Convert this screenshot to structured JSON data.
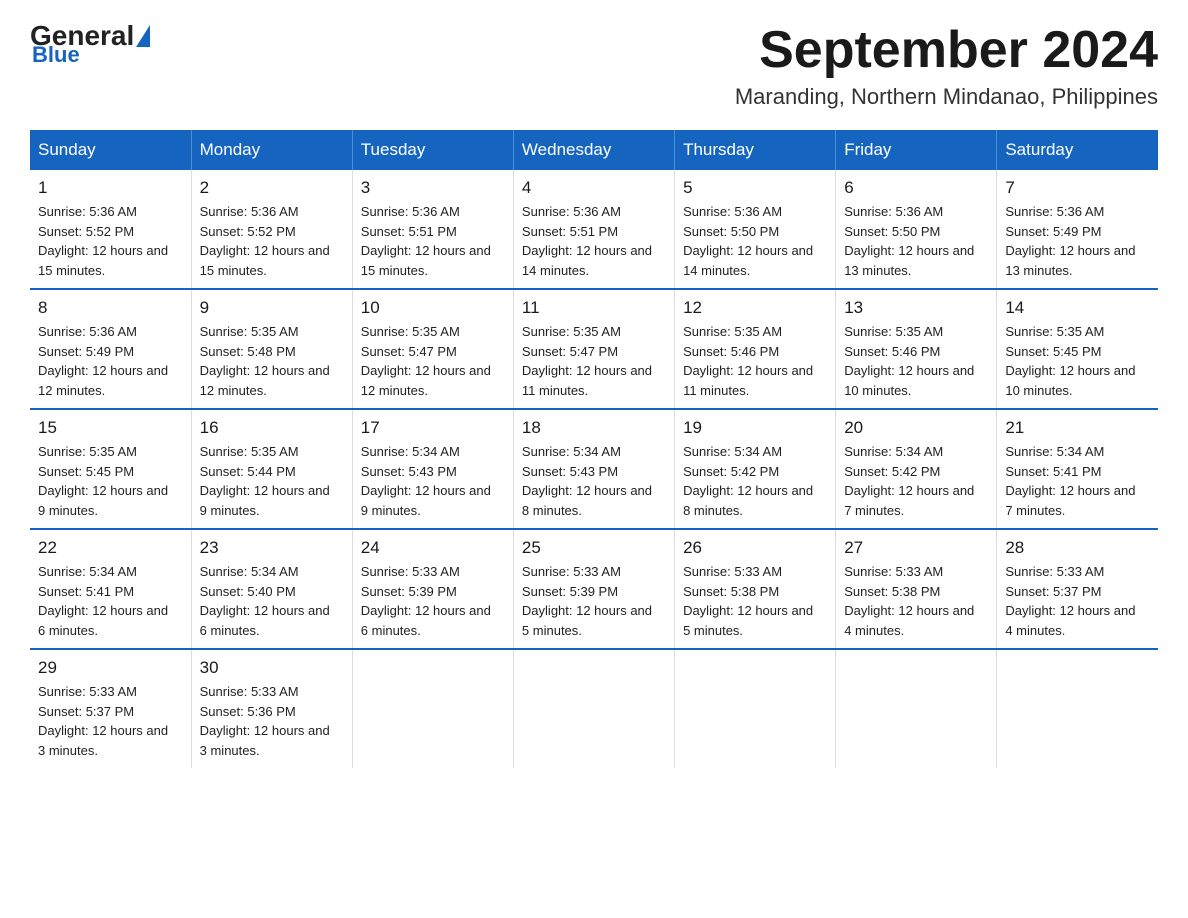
{
  "header": {
    "logo": {
      "general": "General",
      "blue": "Blue"
    },
    "title": "September 2024",
    "location": "Maranding, Northern Mindanao, Philippines"
  },
  "weekdays": [
    "Sunday",
    "Monday",
    "Tuesday",
    "Wednesday",
    "Thursday",
    "Friday",
    "Saturday"
  ],
  "weeks": [
    [
      {
        "day": "1",
        "sunrise": "5:36 AM",
        "sunset": "5:52 PM",
        "daylight": "12 hours and 15 minutes."
      },
      {
        "day": "2",
        "sunrise": "5:36 AM",
        "sunset": "5:52 PM",
        "daylight": "12 hours and 15 minutes."
      },
      {
        "day": "3",
        "sunrise": "5:36 AM",
        "sunset": "5:51 PM",
        "daylight": "12 hours and 15 minutes."
      },
      {
        "day": "4",
        "sunrise": "5:36 AM",
        "sunset": "5:51 PM",
        "daylight": "12 hours and 14 minutes."
      },
      {
        "day": "5",
        "sunrise": "5:36 AM",
        "sunset": "5:50 PM",
        "daylight": "12 hours and 14 minutes."
      },
      {
        "day": "6",
        "sunrise": "5:36 AM",
        "sunset": "5:50 PM",
        "daylight": "12 hours and 13 minutes."
      },
      {
        "day": "7",
        "sunrise": "5:36 AM",
        "sunset": "5:49 PM",
        "daylight": "12 hours and 13 minutes."
      }
    ],
    [
      {
        "day": "8",
        "sunrise": "5:36 AM",
        "sunset": "5:49 PM",
        "daylight": "12 hours and 12 minutes."
      },
      {
        "day": "9",
        "sunrise": "5:35 AM",
        "sunset": "5:48 PM",
        "daylight": "12 hours and 12 minutes."
      },
      {
        "day": "10",
        "sunrise": "5:35 AM",
        "sunset": "5:47 PM",
        "daylight": "12 hours and 12 minutes."
      },
      {
        "day": "11",
        "sunrise": "5:35 AM",
        "sunset": "5:47 PM",
        "daylight": "12 hours and 11 minutes."
      },
      {
        "day": "12",
        "sunrise": "5:35 AM",
        "sunset": "5:46 PM",
        "daylight": "12 hours and 11 minutes."
      },
      {
        "day": "13",
        "sunrise": "5:35 AM",
        "sunset": "5:46 PM",
        "daylight": "12 hours and 10 minutes."
      },
      {
        "day": "14",
        "sunrise": "5:35 AM",
        "sunset": "5:45 PM",
        "daylight": "12 hours and 10 minutes."
      }
    ],
    [
      {
        "day": "15",
        "sunrise": "5:35 AM",
        "sunset": "5:45 PM",
        "daylight": "12 hours and 9 minutes."
      },
      {
        "day": "16",
        "sunrise": "5:35 AM",
        "sunset": "5:44 PM",
        "daylight": "12 hours and 9 minutes."
      },
      {
        "day": "17",
        "sunrise": "5:34 AM",
        "sunset": "5:43 PM",
        "daylight": "12 hours and 9 minutes."
      },
      {
        "day": "18",
        "sunrise": "5:34 AM",
        "sunset": "5:43 PM",
        "daylight": "12 hours and 8 minutes."
      },
      {
        "day": "19",
        "sunrise": "5:34 AM",
        "sunset": "5:42 PM",
        "daylight": "12 hours and 8 minutes."
      },
      {
        "day": "20",
        "sunrise": "5:34 AM",
        "sunset": "5:42 PM",
        "daylight": "12 hours and 7 minutes."
      },
      {
        "day": "21",
        "sunrise": "5:34 AM",
        "sunset": "5:41 PM",
        "daylight": "12 hours and 7 minutes."
      }
    ],
    [
      {
        "day": "22",
        "sunrise": "5:34 AM",
        "sunset": "5:41 PM",
        "daylight": "12 hours and 6 minutes."
      },
      {
        "day": "23",
        "sunrise": "5:34 AM",
        "sunset": "5:40 PM",
        "daylight": "12 hours and 6 minutes."
      },
      {
        "day": "24",
        "sunrise": "5:33 AM",
        "sunset": "5:39 PM",
        "daylight": "12 hours and 6 minutes."
      },
      {
        "day": "25",
        "sunrise": "5:33 AM",
        "sunset": "5:39 PM",
        "daylight": "12 hours and 5 minutes."
      },
      {
        "day": "26",
        "sunrise": "5:33 AM",
        "sunset": "5:38 PM",
        "daylight": "12 hours and 5 minutes."
      },
      {
        "day": "27",
        "sunrise": "5:33 AM",
        "sunset": "5:38 PM",
        "daylight": "12 hours and 4 minutes."
      },
      {
        "day": "28",
        "sunrise": "5:33 AM",
        "sunset": "5:37 PM",
        "daylight": "12 hours and 4 minutes."
      }
    ],
    [
      {
        "day": "29",
        "sunrise": "5:33 AM",
        "sunset": "5:37 PM",
        "daylight": "12 hours and 3 minutes."
      },
      {
        "day": "30",
        "sunrise": "5:33 AM",
        "sunset": "5:36 PM",
        "daylight": "12 hours and 3 minutes."
      },
      null,
      null,
      null,
      null,
      null
    ]
  ]
}
